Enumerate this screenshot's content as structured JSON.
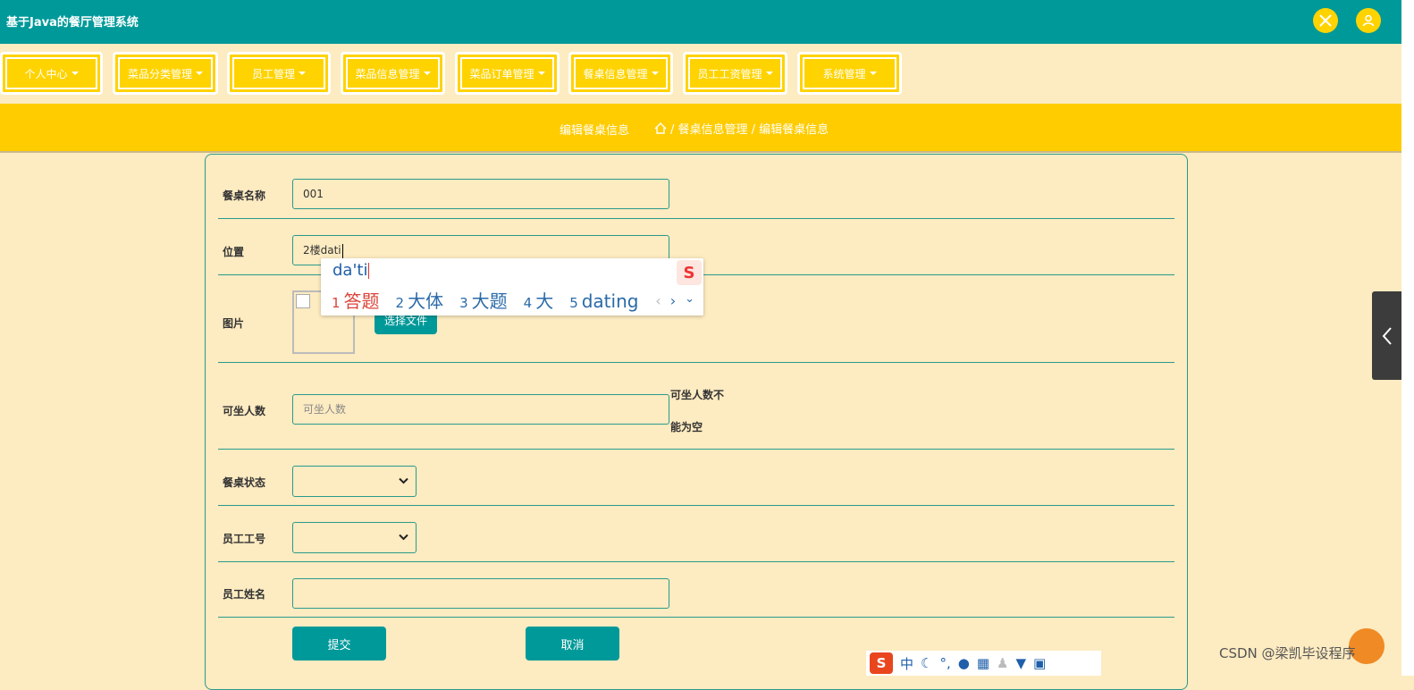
{
  "app": {
    "title": "基于Java的餐厅管理系统"
  },
  "topbar": {
    "icons": [
      "expand-icon",
      "user-icon"
    ]
  },
  "nav": {
    "items": [
      {
        "label": "个人中心"
      },
      {
        "label": "菜品分类管理"
      },
      {
        "label": "员工管理"
      },
      {
        "label": "菜品信息管理"
      },
      {
        "label": "菜品订单管理"
      },
      {
        "label": "餐桌信息管理"
      },
      {
        "label": "员工工资管理"
      },
      {
        "label": "系统管理"
      }
    ]
  },
  "breadcrumb": {
    "title": "编辑餐桌信息",
    "path": "/ 餐桌信息管理 / 编辑餐桌信息"
  },
  "form": {
    "table_name": {
      "label": "餐桌名称",
      "value": "001"
    },
    "location": {
      "label": "位置",
      "value": "2楼dati"
    },
    "image": {
      "label": "图片",
      "button": "选择文件"
    },
    "capacity": {
      "label": "可坐人数",
      "placeholder": "可坐人数",
      "error_line1": "可坐人数不",
      "error_line2": "能为空"
    },
    "table_status": {
      "label": "餐桌状态",
      "value": ""
    },
    "employee_id": {
      "label": "员工工号",
      "value": ""
    },
    "employee_name": {
      "label": "员工姓名",
      "value": ""
    },
    "submit": "提交",
    "cancel": "取消"
  },
  "ime": {
    "pinyin": "da'ti",
    "candidates": [
      {
        "num": "1",
        "text": "答题"
      },
      {
        "num": "2",
        "text": "大体"
      },
      {
        "num": "3",
        "text": "大题"
      },
      {
        "num": "4",
        "text": "大"
      },
      {
        "num": "5",
        "text": "dating"
      }
    ],
    "logo": "S",
    "toolbar_label": "中"
  },
  "watermark": "CSDN @梁凯毕设程序",
  "colors": {
    "header": "#009999",
    "accent": "#ffd300",
    "background": "#fdebc1",
    "candidate_selected": "#d9443a"
  }
}
